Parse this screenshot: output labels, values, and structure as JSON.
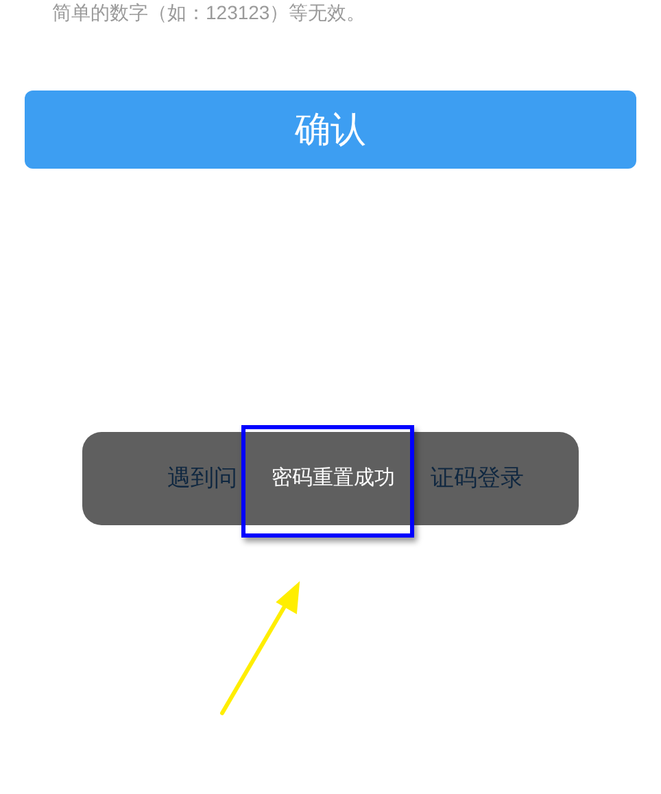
{
  "hint_text": "简单的数字（如：123123）等无效。",
  "confirm_button": {
    "label": "确认"
  },
  "help_link": {
    "visible_parts": [
      "遇到问",
      "证码登录"
    ]
  },
  "toast": {
    "message": "密码重置成功"
  }
}
